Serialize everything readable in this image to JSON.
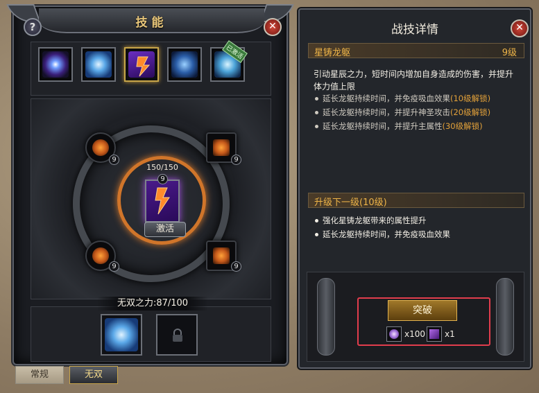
{
  "left_panel": {
    "title": "技能",
    "help_label": "?",
    "close_label": "✕",
    "skill_slots": [
      {
        "icon": "vortex-skill-icon"
      },
      {
        "icon": "shield-skill-icon"
      },
      {
        "icon": "dragon-armor-skill-icon",
        "selected": true
      },
      {
        "icon": "figure-skill-icon"
      },
      {
        "icon": "ice-skill-icon",
        "tag": "已激活"
      }
    ],
    "core": {
      "count": "150/150",
      "level": "9",
      "activate_label": "激活"
    },
    "sub_nodes": [
      {
        "icon": "sun-rune-icon",
        "level": "9"
      },
      {
        "icon": "flame-rune-icon",
        "level": "9"
      },
      {
        "icon": "sun-rune-icon",
        "level": "9"
      },
      {
        "icon": "diamond-rune-icon",
        "level": "9"
      }
    ],
    "power_label": "无双之力:87/100",
    "bottom_slots": [
      {
        "icon": "shield-skill-icon"
      },
      {
        "icon": "lock-icon"
      }
    ],
    "tabs": [
      {
        "label": "常规",
        "active": false
      },
      {
        "label": "无双",
        "active": true
      }
    ]
  },
  "right_panel": {
    "title": "战技详情",
    "close_label": "✕",
    "skill_name": "星铸龙躯",
    "skill_level": "9级",
    "description": "引动星辰之力，短时间内增加自身造成的伤害，并提升体力值上限",
    "bullets": [
      {
        "text": "延长龙躯持续时间，并免疫吸血效果",
        "lock": "(10级解锁)"
      },
      {
        "text": "延长龙躯持续时间，并提升神圣攻击",
        "lock": "(20级解锁)"
      },
      {
        "text": "延长龙躯持续时间，并提升主属性",
        "lock": "(30级解锁)"
      }
    ],
    "next_title": "升级下一级(10级)",
    "next_bullets": [
      "强化星铸龙躯带来的属性提升",
      "延长龙躯持续时间，并免疫吸血效果"
    ],
    "break_label": "突破",
    "costs": [
      {
        "icon": "crystal-icon",
        "amount": "x100"
      },
      {
        "icon": "book-icon",
        "amount": "x1"
      }
    ]
  },
  "colors": {
    "accent_gold": "#efb548",
    "highlight_red": "#e23d4d",
    "orange_ring": "#d0752a"
  }
}
